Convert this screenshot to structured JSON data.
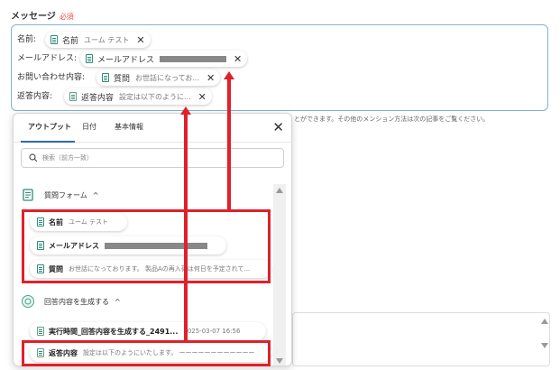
{
  "field": {
    "label": "メッセージ",
    "required": "必須"
  },
  "rows": [
    {
      "label": "名前:",
      "chip": "名前",
      "sub": "ユーム テスト"
    },
    {
      "label": "メールアドレス:",
      "chip": "メールアドレス",
      "sub": ""
    },
    {
      "label": "お問い合わせ内容:",
      "chip": "質問",
      "sub": "お世話になってお..."
    },
    {
      "label": "返答内容:",
      "chip": "返答内容",
      "sub": "設定は以下のように..."
    }
  ],
  "hint": "とができます。その他のメンション方法は次の記事をご覧ください。",
  "panel": {
    "tabs": [
      "アウトプット",
      "日付",
      "基本情報"
    ],
    "search_placeholder": "検索（前方一致）",
    "section1": {
      "title": "質問フォーム",
      "caret": "^"
    },
    "section1_items": [
      {
        "name": "名前",
        "sub": "ユーム テスト"
      },
      {
        "name": "メールアドレス",
        "sub": ""
      },
      {
        "name": "質問",
        "sub": "お世話になっております。 製品Aの再入荷は何日を予定されて..."
      }
    ],
    "section2": {
      "title": "回答内容を生成する",
      "caret": "^"
    },
    "section2_items": [
      {
        "name": "実行時間_回答内容を生成する_2491...",
        "sub": "2025-03-07 16:56"
      },
      {
        "name": "返答内容",
        "sub": "設定は以下のようにいたします。 ーーーーーーーーーーーー"
      }
    ]
  },
  "colors": {
    "annotation": "#e0202a",
    "accent": "#2b6cb0",
    "chip_icon": "#2e8b7a"
  }
}
